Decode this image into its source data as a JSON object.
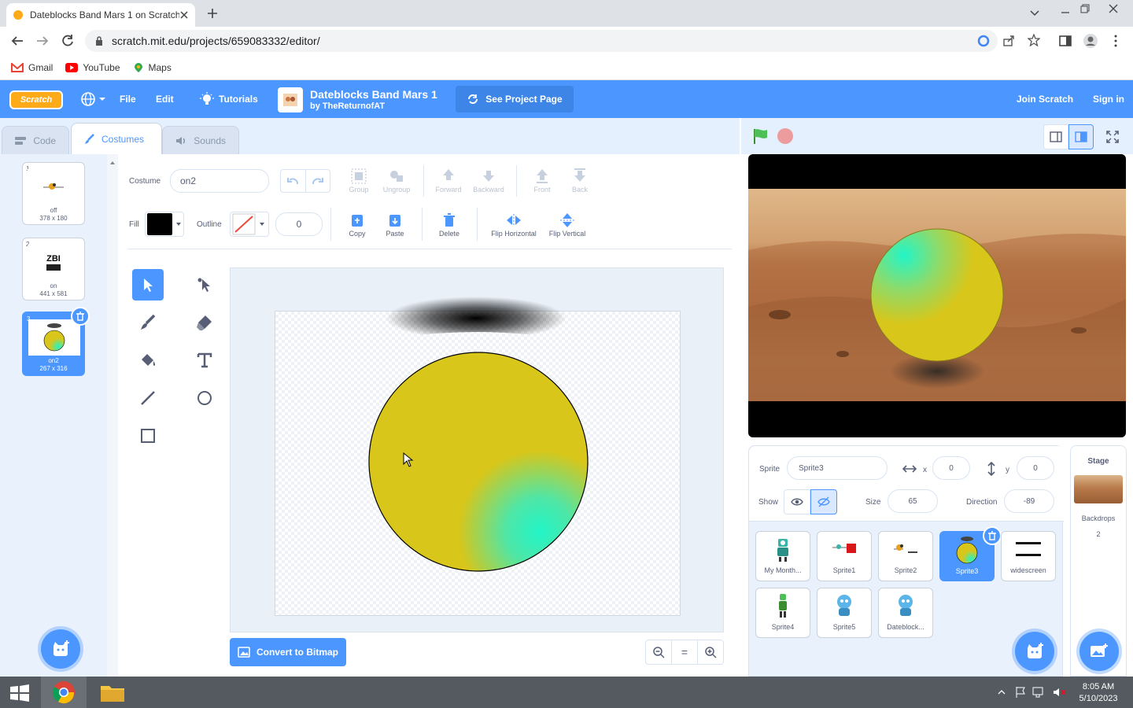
{
  "browser": {
    "tab_title": "Dateblocks Band Mars 1 on Scratch",
    "url": "scratch.mit.edu/projects/659083332/editor/",
    "bookmarks": [
      "Gmail",
      "YouTube",
      "Maps"
    ]
  },
  "scratch_menu": {
    "logo": "Scratch",
    "file": "File",
    "edit": "Edit",
    "tutorials": "Tutorials",
    "project_title": "Dateblocks Band Mars 1",
    "project_author": "by TheReturnofAT",
    "see_project_page": "See Project Page",
    "join": "Join Scratch",
    "sign_in": "Sign in"
  },
  "editor_tabs": [
    "Code",
    "Costumes",
    "Sounds"
  ],
  "costumes": [
    {
      "num": "1",
      "name": "off",
      "size": "378 x 180"
    },
    {
      "num": "2",
      "name": "on",
      "size": "441 x 581",
      "thumb_text": "ZBI"
    },
    {
      "num": "3",
      "name": "on2",
      "size": "267 x 316"
    }
  ],
  "paint": {
    "costume_label": "Costume",
    "costume_name": "on2",
    "group": "Group",
    "ungroup": "Ungroup",
    "forward": "Forward",
    "backward": "Backward",
    "front": "Front",
    "back": "Back",
    "fill_label": "Fill",
    "outline_label": "Outline",
    "outline_width": "0",
    "copy": "Copy",
    "paste": "Paste",
    "delete": "Delete",
    "flip_h": "Flip Horizontal",
    "flip_v": "Flip Vertical",
    "convert": "Convert to Bitmap",
    "zoom_reset": "="
  },
  "sprite_info": {
    "sprite_label": "Sprite",
    "sprite_name": "Sprite3",
    "x_label": "x",
    "x": "0",
    "y_label": "y",
    "y": "0",
    "show_label": "Show",
    "size_label": "Size",
    "size": "65",
    "direction_label": "Direction",
    "direction": "-89"
  },
  "sprites": [
    "My Month...",
    "Sprite1",
    "Sprite2",
    "Sprite3",
    "widescreen",
    "Sprite4",
    "Sprite5",
    "Dateblock..."
  ],
  "stage_pane": {
    "title": "Stage",
    "backdrops_label": "Backdrops",
    "backdrops_count": "2"
  },
  "taskbar": {
    "time": "8:05 AM",
    "date": "5/10/2023"
  },
  "colors": {
    "scratch_blue": "#4c97ff",
    "fill": "#000000",
    "circle_yellow": "#d8c61a",
    "circle_cyan": "#22f5c8"
  }
}
